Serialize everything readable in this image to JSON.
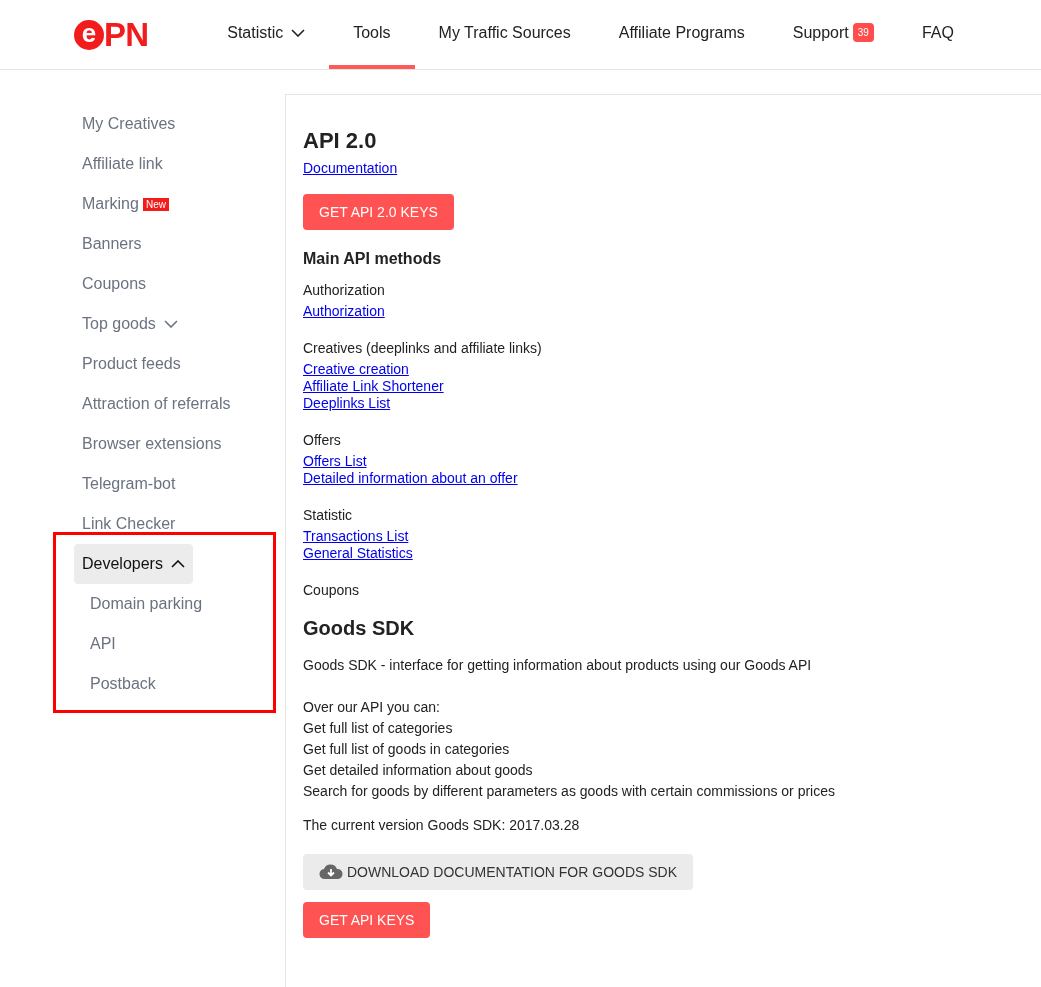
{
  "header": {
    "logo": {
      "circle_letter": "e",
      "text": "PN"
    },
    "nav": [
      {
        "label": "Statistic",
        "selected": false,
        "dropdown": true
      },
      {
        "label": "Tools",
        "selected": true,
        "dropdown": false
      },
      {
        "label": "My Traffic Sources",
        "selected": false,
        "dropdown": false
      },
      {
        "label": "Affiliate Programs",
        "selected": false,
        "dropdown": false
      },
      {
        "label": "Support",
        "selected": false,
        "dropdown": false,
        "badge": "39"
      },
      {
        "label": "FAQ",
        "selected": false,
        "dropdown": false
      }
    ]
  },
  "sidebar": {
    "items": [
      {
        "kind": "item",
        "label": "My Creatives",
        "selected": false
      },
      {
        "kind": "item",
        "label": "Affiliate link",
        "selected": false
      },
      {
        "kind": "item",
        "label": "Marking",
        "badge": "New",
        "selected": false
      },
      {
        "kind": "item",
        "label": "Banners",
        "selected": false
      },
      {
        "kind": "item",
        "label": "Coupons",
        "selected": false
      },
      {
        "kind": "group",
        "label": "Top goods",
        "expanded": false,
        "selected": false
      },
      {
        "kind": "item",
        "label": "Product feeds",
        "selected": false
      },
      {
        "kind": "item",
        "label": "Attraction of referrals",
        "selected": false
      },
      {
        "kind": "item",
        "label": "Browser extensions",
        "selected": false
      },
      {
        "kind": "item",
        "label": "Telegram-bot",
        "selected": false
      },
      {
        "kind": "item",
        "label": "Link Checker",
        "selected": false
      },
      {
        "kind": "group",
        "label": "Developers",
        "expanded": true,
        "selected": true,
        "highlighted": true,
        "children": [
          {
            "label": "Domain parking",
            "selected": false
          },
          {
            "label": "API",
            "selected": false
          },
          {
            "label": "Postback",
            "selected": false
          }
        ]
      }
    ]
  },
  "api": {
    "title": "API 2.0",
    "link": "Documentation",
    "button": "GET API 2.0 KEYS",
    "methods_title": "Main API methods",
    "groups": [
      {
        "title": "Authorization",
        "links": [
          "Authorization"
        ]
      },
      {
        "title": "Creatives (deeplinks and affiliate links)",
        "links": [
          "Creative creation",
          "Affiliate Link Shortener",
          "Deeplinks List"
        ]
      },
      {
        "title": "Offers",
        "links": [
          "Offers List",
          "Detailed information about an offer"
        ]
      },
      {
        "title": "Statistic",
        "links": [
          "Transactions List",
          "General Statistics"
        ]
      },
      {
        "title": "Coupons"
      }
    ]
  },
  "goods_sdk": {
    "title": "Goods SDK",
    "description": "Goods SDK - interface for getting information about products using our Goods API",
    "lines": [
      "Over our API you can:",
      "Get full list of categories",
      "Get full list of goods in categories",
      "Get detailed information about goods",
      "Search for goods by different parameters as goods with certain commissions or prices"
    ],
    "version": "The current version Goods SDK: 2017.03.28",
    "download_button": "DOWNLOAD DOCUMENTATION FOR GOODS SDK",
    "keys_button": "GET API KEYS"
  }
}
